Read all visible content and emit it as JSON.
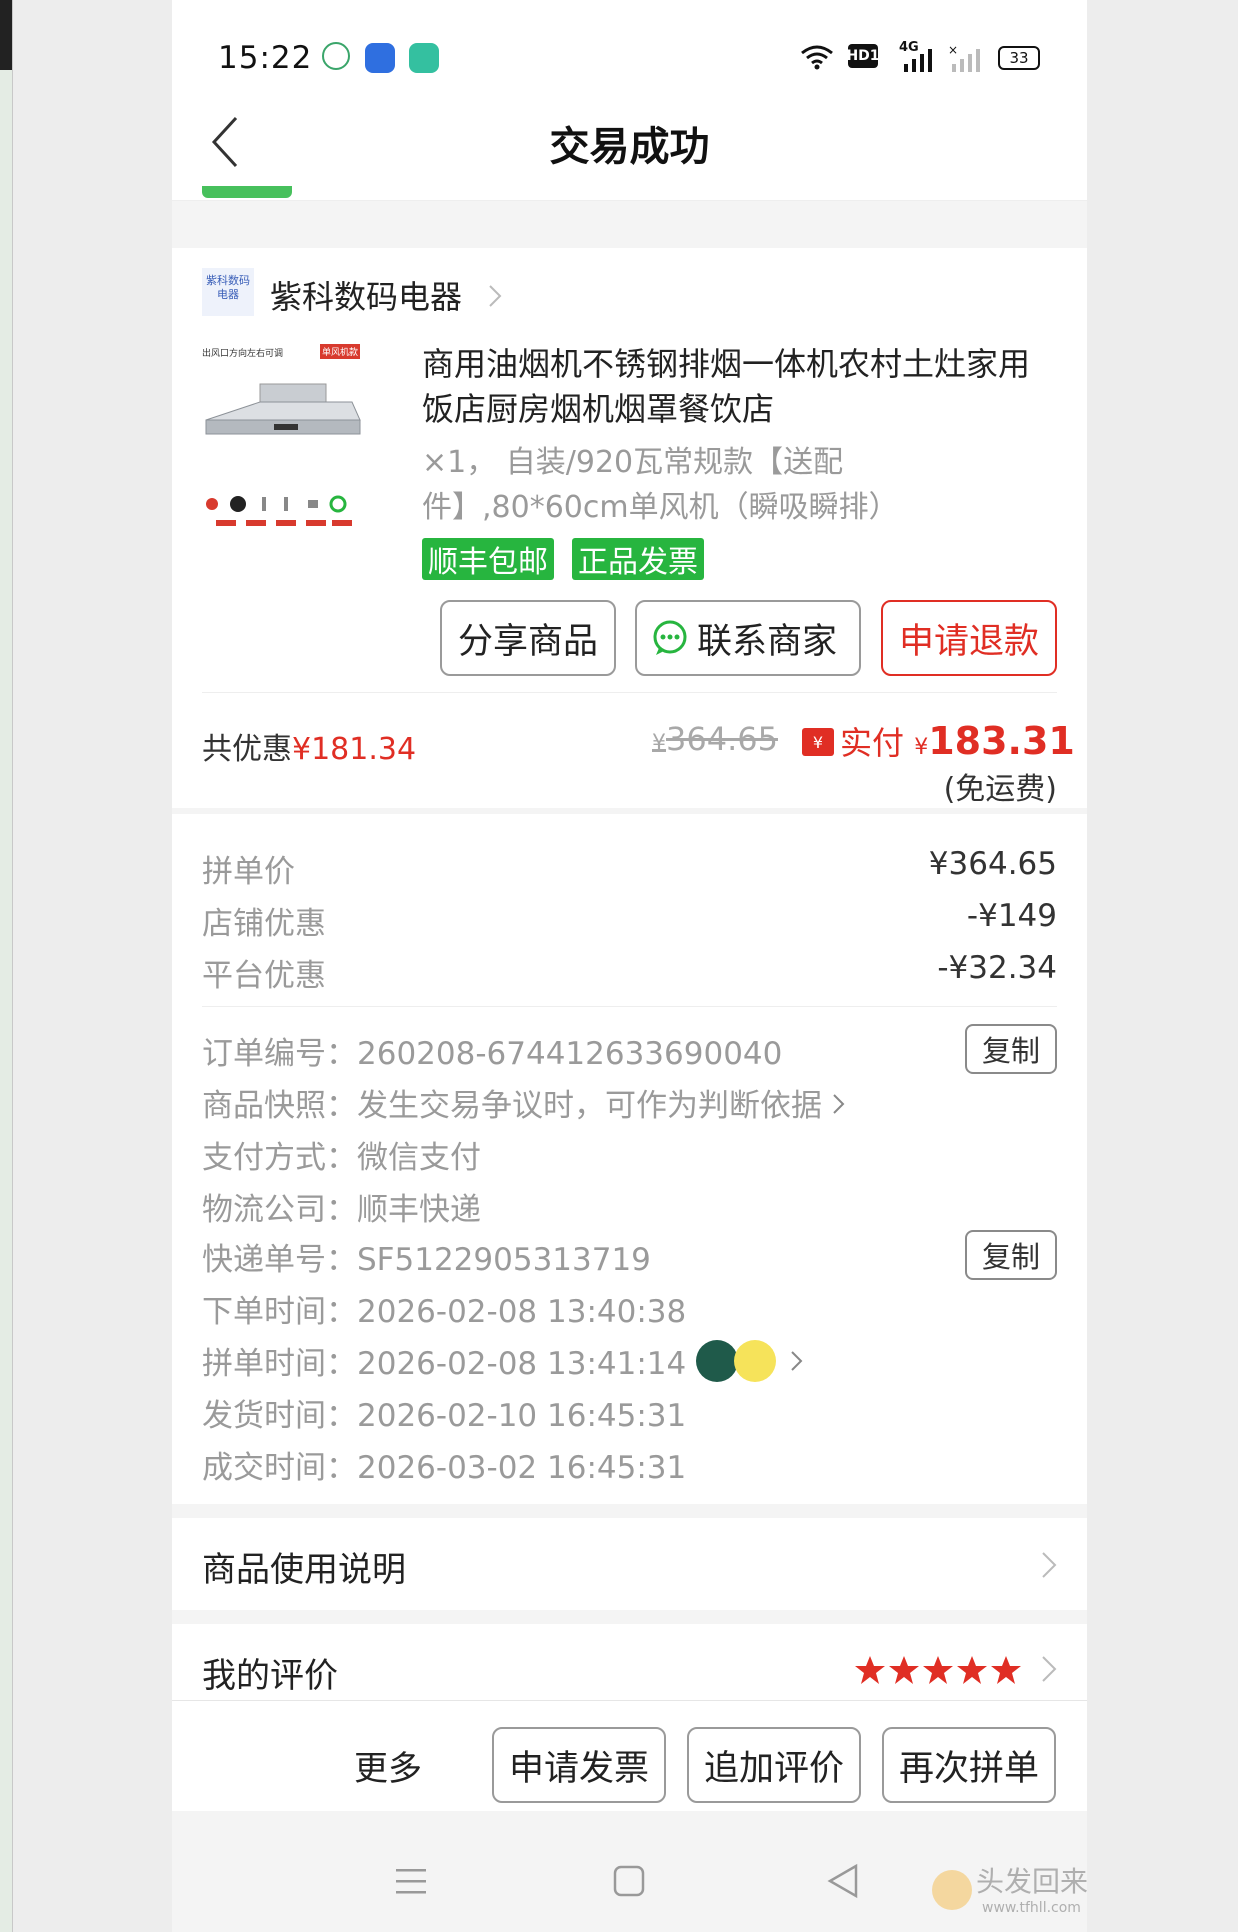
{
  "status_bar": {
    "time": "15:22",
    "network": "4G",
    "hd": "HD1",
    "battery": "33"
  },
  "header": {
    "title": "交易成功"
  },
  "shop": {
    "logo_text": "紫科数码电器",
    "name": "紫科数码电器"
  },
  "product": {
    "image_caption_left": "出风口方向左右可调",
    "image_caption_right": "单风机款",
    "title": "商用油烟机不锈钢排烟一体机农村土灶家用饭店厨房烟机烟罩餐饮店",
    "spec": "×1，  自装/920瓦常规款【送配件】,80*60cm单风机（瞬吸瞬排）",
    "tags": [
      "顺丰包邮",
      "正品发票"
    ]
  },
  "actions": {
    "share": "分享商品",
    "contact": "联系商家",
    "refund": "申请退款"
  },
  "price_summary": {
    "discount_label": "共优惠",
    "discount_value": "¥181.34",
    "original_currency": "¥",
    "original_price": "364.65",
    "paid_label": "实付",
    "paid_currency": "¥",
    "paid_price": "183.31",
    "shipping_note": "(免运费)"
  },
  "price_details": [
    {
      "label": "拼单价",
      "value": "¥364.65"
    },
    {
      "label": "店铺优惠",
      "value": "-¥149"
    },
    {
      "label": "平台优惠",
      "value": "-¥32.34"
    }
  ],
  "order_info": {
    "order_no": "订单编号：260208-674412633690040",
    "snapshot": "商品快照：发生交易争议时，可作为判断依据",
    "payment": "支付方式：微信支付",
    "courier": "物流公司：顺丰快递",
    "tracking": "快递单号：SF5122905313719",
    "order_time": "下单时间：2026-02-08 13:40:38",
    "group_time": "拼单时间：2026-02-08 13:41:14",
    "ship_time": "发货时间：2026-02-10 16:45:31",
    "deal_time": "成交时间：2026-03-02 16:45:31",
    "copy_label": "复制"
  },
  "usage": {
    "label": "商品使用说明"
  },
  "review": {
    "label": "我的评价",
    "stars": 5
  },
  "bottom_bar": {
    "more": "更多",
    "invoice": "申请发票",
    "append_review": "追加评价",
    "regroup": "再次拼单"
  },
  "watermark": {
    "text": "头发回来了",
    "url": "www.tfhll.com"
  },
  "colors": {
    "accent_red": "#e02e24",
    "tag_green": "#27b53f",
    "page_bg": "#f4f4f4"
  }
}
